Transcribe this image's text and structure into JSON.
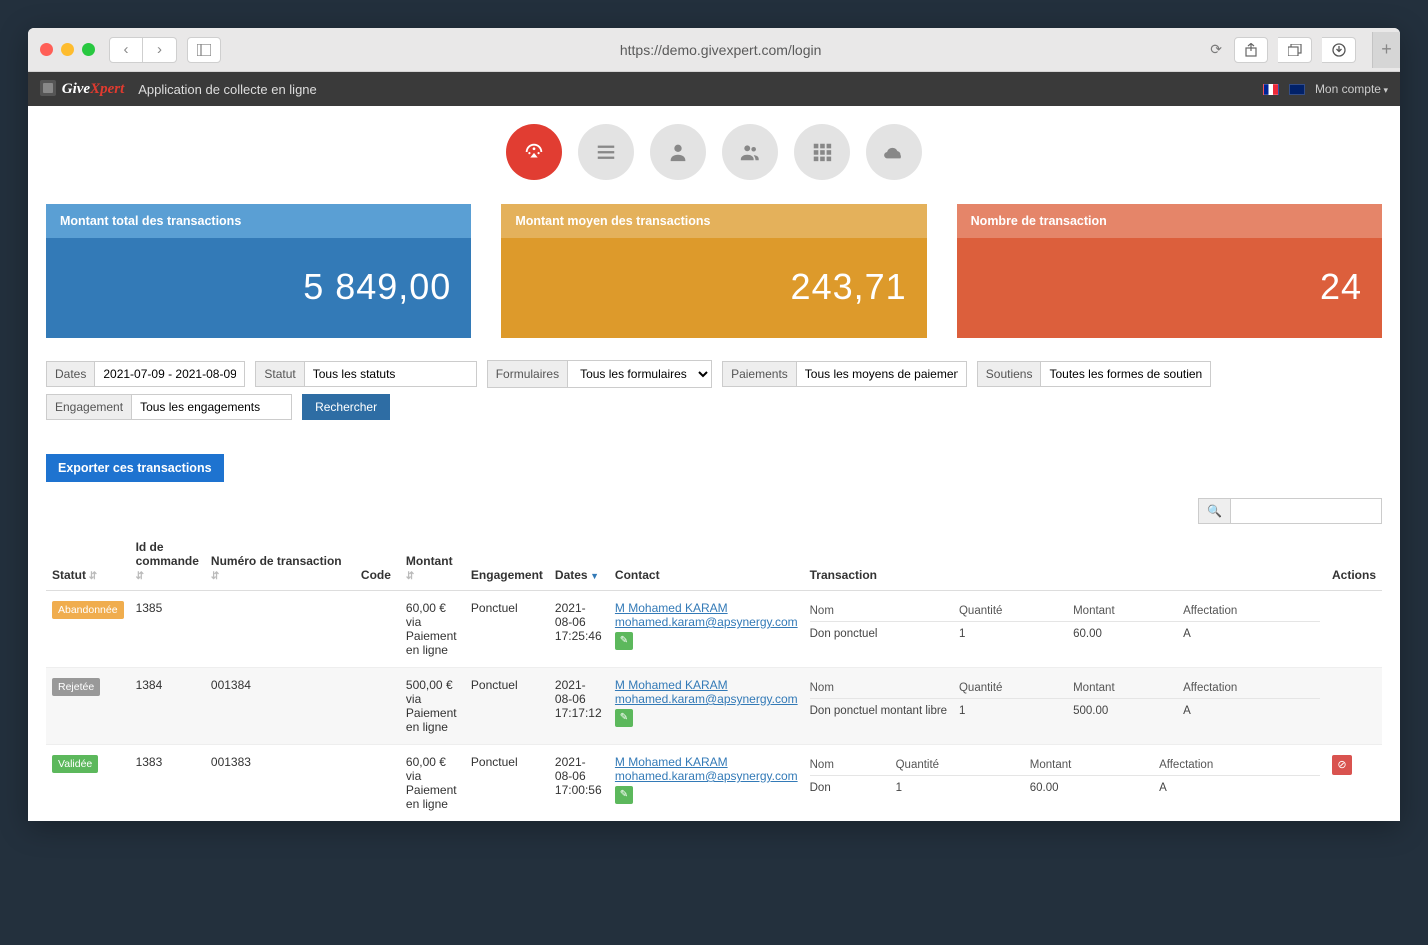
{
  "browser": {
    "url": "https://demo.givexpert.com/login"
  },
  "header": {
    "logo_part1": "Give",
    "logo_part2": "Xpert",
    "app_title": "Application de collecte en ligne",
    "account_label": "Mon compte"
  },
  "stats": {
    "total": {
      "label": "Montant total des transactions",
      "value": "5 849,00"
    },
    "avg": {
      "label": "Montant moyen des transactions",
      "value": "243,71"
    },
    "count": {
      "label": "Nombre de transaction",
      "value": "24"
    }
  },
  "filters": {
    "dates_label": "Dates",
    "dates_value": "2021-07-09 - 2021-08-09",
    "statut_label": "Statut",
    "statut_value": "Tous les statuts",
    "formulaires_label": "Formulaires",
    "formulaires_value": "Tous les formulaires",
    "paiements_label": "Paiements",
    "paiements_value": "Tous les moyens de paiement",
    "soutiens_label": "Soutiens",
    "soutiens_value": "Toutes les formes de soutiens",
    "engagement_label": "Engagement",
    "engagement_value": "Tous les engagements",
    "search_button": "Rechercher"
  },
  "export_button": "Exporter ces transactions",
  "table": {
    "headers": {
      "statut": "Statut",
      "id_commande": "Id de commande",
      "numero": "Numéro de transaction",
      "code": "Code",
      "montant": "Montant",
      "engagement": "Engagement",
      "dates": "Dates",
      "contact": "Contact",
      "transaction": "Transaction",
      "actions": "Actions"
    },
    "inner_headers": {
      "nom": "Nom",
      "qte": "Quantité",
      "montant": "Montant",
      "affectation": "Affectation"
    },
    "rows": [
      {
        "status_label": "Abandonnée",
        "status_class": "abandonnee",
        "order_id": "1385",
        "txn_number": "",
        "amount_line1": "60,00 €",
        "amount_line2": "via",
        "amount_line3": "Paiement en ligne",
        "engagement": "Ponctuel",
        "date": "2021-08-06 17:25:46",
        "contact_name": "M Mohamed KARAM",
        "contact_email": "mohamed.karam@apsynergy.com",
        "inner": {
          "nom": "Don ponctuel",
          "qte": "1",
          "montant": "60.00",
          "affectation": "A"
        },
        "has_delete": false
      },
      {
        "status_label": "Rejetée",
        "status_class": "rejetee",
        "order_id": "1384",
        "txn_number": "001384",
        "amount_line1": "500,00 €",
        "amount_line2": "via",
        "amount_line3": "Paiement en ligne",
        "engagement": "Ponctuel",
        "date": "2021-08-06 17:17:12",
        "contact_name": "M Mohamed KARAM",
        "contact_email": "mohamed.karam@apsynergy.com",
        "inner": {
          "nom": "Don ponctuel montant libre",
          "qte": "1",
          "montant": "500.00",
          "affectation": "A"
        },
        "has_delete": false
      },
      {
        "status_label": "Validée",
        "status_class": "validee",
        "order_id": "1383",
        "txn_number": "001383",
        "amount_line1": "60,00 €",
        "amount_line2": "via",
        "amount_line3": "Paiement en ligne",
        "engagement": "Ponctuel",
        "date": "2021-08-06 17:00:56",
        "contact_name": "M Mohamed KARAM",
        "contact_email": "mohamed.karam@apsynergy.com",
        "inner": {
          "nom": "Don",
          "qte": "1",
          "montant": "60.00",
          "affectation": "A"
        },
        "has_delete": true
      }
    ]
  }
}
